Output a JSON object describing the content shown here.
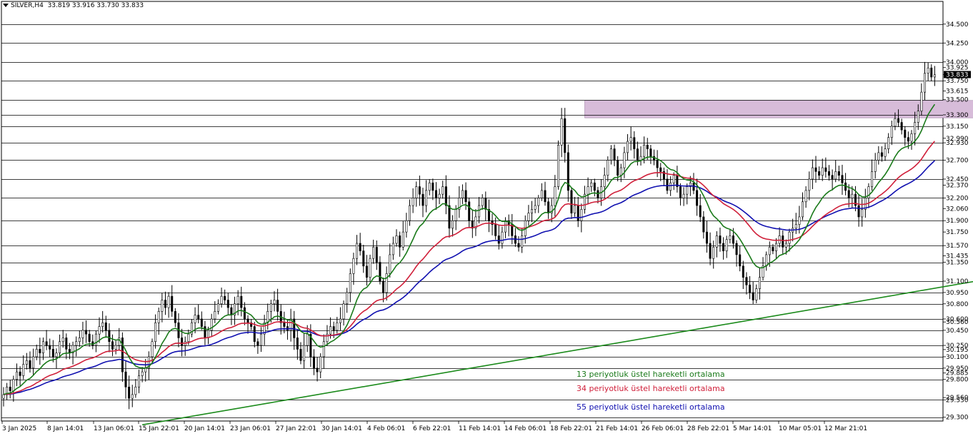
{
  "header": {
    "symbol": "SILVER,H4",
    "ohlc": "33.819 33.916 33.730 33.833"
  },
  "colors": {
    "ema13": "#1a7a1a",
    "ema34": "#d0203a",
    "ema55": "#1010b0",
    "trendline": "#1a8a1a",
    "zone": "#d7bcd9",
    "candle": "#000000",
    "grid": "#000000"
  },
  "legend": [
    {
      "key": "ema13",
      "text": "13 periyotluk üstel hareketli ortalama"
    },
    {
      "key": "ema34",
      "text": "34 periyotluk üstel hareketli ortalama"
    },
    {
      "key": "ema55",
      "text": "55 periyotluk üstel hareketli ortalama"
    }
  ],
  "chart_data": {
    "type": "candlestick",
    "ylim": [
      29.25,
      34.8
    ],
    "current_price": 33.833,
    "y_ticks": [
      "34.500",
      "34.250",
      "34.000",
      "33.925",
      "33.833",
      "33.750",
      "33.615",
      "33.500",
      "33.300",
      "33.150",
      "32.990",
      "32.930",
      "32.700",
      "32.450",
      "32.370",
      "32.200",
      "32.060",
      "31.900",
      "31.750",
      "31.570",
      "31.435",
      "31.350",
      "31.100",
      "30.950",
      "30.800",
      "30.600",
      "30.560",
      "30.450",
      "30.250",
      "30.195",
      "30.100",
      "29.950",
      "29.885",
      "29.800",
      "29.560",
      "29.530",
      "29.300"
    ],
    "level_lines": [
      34.5,
      34.25,
      34.0,
      33.75,
      33.5,
      33.3,
      33.15,
      32.93,
      32.7,
      32.45,
      32.2,
      31.9,
      31.57,
      31.35,
      31.1,
      30.95,
      30.8,
      30.6,
      30.45,
      30.25,
      30.1,
      29.95,
      29.8,
      29.53,
      29.3
    ],
    "x_ticks": [
      "3 Jan 2025",
      "8 Jan 14:01",
      "13 Jan 06:01",
      "15 Jan 22:01",
      "20 Jan 14:01",
      "23 Jan 06:01",
      "27 Jan 22:01",
      "30 Jan 14:01",
      "4 Feb 06:01",
      "6 Feb 22:01",
      "11 Feb 14:01",
      "14 Feb 06:01",
      "18 Feb 22:01",
      "21 Feb 14:01",
      "26 Feb 06:01",
      "28 Feb 22:01",
      "5 Mar 14:01",
      "10 Mar 05:01",
      "12 Mar 21:01"
    ],
    "resistance_zone": {
      "low": 33.26,
      "high": 33.49,
      "from_index": 176,
      "to_index": 316
    },
    "trendline": {
      "from": {
        "index": 42,
        "price": 29.2
      },
      "to": {
        "index": 353,
        "price": 31.54
      }
    },
    "closes": [
      29.6,
      29.7,
      29.65,
      29.8,
      29.9,
      29.85,
      30.0,
      30.05,
      29.95,
      30.1,
      30.2,
      30.15,
      30.3,
      30.25,
      30.2,
      30.1,
      30.15,
      30.3,
      30.35,
      30.2,
      30.15,
      30.25,
      30.3,
      30.35,
      30.45,
      30.4,
      30.3,
      30.25,
      30.4,
      30.5,
      30.55,
      30.45,
      30.3,
      30.2,
      30.25,
      30.35,
      29.9,
      29.7,
      29.55,
      29.6,
      29.7,
      29.85,
      29.9,
      29.95,
      30.1,
      30.3,
      30.55,
      30.7,
      30.85,
      30.75,
      30.9,
      30.7,
      30.55,
      30.35,
      30.25,
      30.3,
      30.4,
      30.55,
      30.65,
      30.6,
      30.5,
      30.35,
      30.45,
      30.6,
      30.7,
      30.8,
      30.9,
      30.85,
      30.75,
      30.65,
      30.8,
      30.9,
      30.75,
      30.6,
      30.55,
      30.5,
      30.3,
      30.25,
      30.4,
      30.55,
      30.7,
      30.8,
      30.85,
      30.7,
      30.55,
      30.5,
      30.45,
      30.6,
      30.35,
      30.2,
      30.05,
      30.25,
      30.4,
      30.1,
      29.95,
      29.9,
      30.1,
      30.3,
      30.4,
      30.5,
      30.45,
      30.55,
      30.6,
      30.8,
      30.95,
      31.2,
      31.4,
      31.6,
      31.5,
      31.3,
      31.15,
      31.4,
      31.55,
      31.35,
      31.1,
      30.95,
      31.2,
      31.45,
      31.6,
      31.7,
      31.55,
      31.75,
      31.9,
      32.1,
      32.2,
      32.35,
      32.25,
      32.1,
      32.3,
      32.4,
      32.3,
      32.2,
      32.25,
      32.35,
      32.1,
      31.8,
      31.9,
      32.05,
      32.2,
      32.3,
      32.15,
      31.9,
      31.8,
      31.95,
      32.1,
      32.2,
      32.05,
      31.9,
      31.85,
      31.7,
      31.6,
      31.75,
      31.9,
      31.85,
      31.7,
      31.6,
      31.55,
      31.7,
      31.9,
      32.0,
      32.05,
      32.1,
      32.2,
      32.3,
      32.15,
      32.0,
      32.1,
      32.35,
      32.9,
      33.25,
      32.8,
      32.3,
      32.0,
      32.1,
      31.9,
      32.05,
      32.25,
      32.35,
      32.4,
      32.3,
      32.2,
      32.35,
      32.5,
      32.7,
      32.85,
      32.7,
      32.5,
      32.6,
      32.8,
      32.95,
      33.0,
      32.85,
      32.7,
      32.75,
      32.9,
      32.85,
      32.75,
      32.7,
      32.6,
      32.55,
      32.45,
      32.3,
      32.4,
      32.5,
      32.35,
      32.2,
      32.25,
      32.35,
      32.4,
      32.3,
      32.1,
      31.95,
      31.75,
      31.6,
      31.4,
      31.55,
      31.7,
      31.6,
      31.5,
      31.65,
      31.7,
      31.6,
      31.45,
      31.3,
      31.15,
      31.05,
      30.95,
      30.85,
      31.0,
      31.15,
      31.3,
      31.45,
      31.55,
      31.5,
      31.6,
      31.7,
      31.55,
      31.6,
      31.75,
      31.8,
      31.85,
      31.95,
      32.15,
      32.3,
      32.45,
      32.6,
      32.55,
      32.5,
      32.6,
      32.55,
      32.5,
      32.45,
      32.55,
      32.5,
      32.4,
      32.3,
      32.2,
      32.25,
      32.1,
      31.95,
      32.05,
      32.2,
      32.35,
      32.55,
      32.7,
      32.8,
      32.75,
      32.85,
      33.0,
      33.15,
      33.25,
      33.2,
      33.1,
      33.0,
      32.95,
      33.05,
      33.2,
      33.35,
      33.6,
      33.85,
      33.92,
      33.8,
      33.83
    ]
  }
}
